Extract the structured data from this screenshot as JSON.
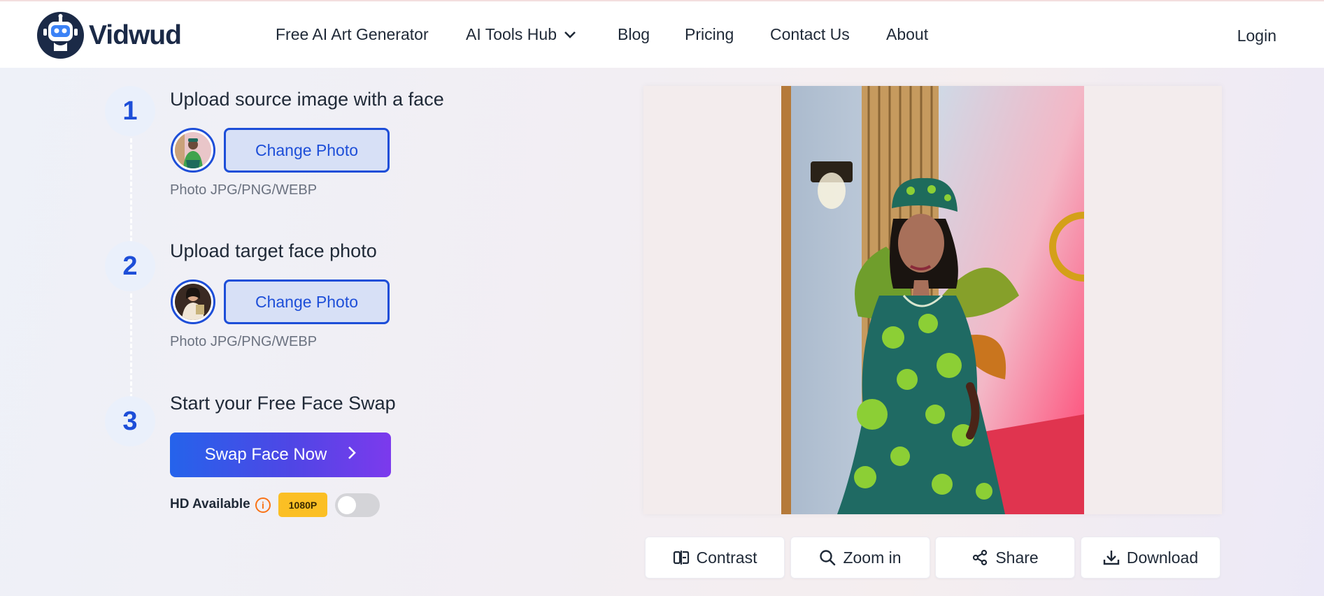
{
  "header": {
    "logo_text": "Vidwud",
    "nav": [
      {
        "label": "Free AI Art Generator"
      },
      {
        "label": "AI Tools Hub"
      },
      {
        "label": "Blog"
      },
      {
        "label": "Pricing"
      },
      {
        "label": "Contact Us"
      },
      {
        "label": "About"
      }
    ],
    "login": "Login"
  },
  "steps": [
    {
      "number": "1",
      "title": "Upload source image with a face",
      "button": "Change Photo",
      "hint": "Photo JPG/PNG/WEBP"
    },
    {
      "number": "2",
      "title": "Upload target face photo",
      "button": "Change Photo",
      "hint": "Photo JPG/PNG/WEBP"
    },
    {
      "number": "3",
      "title": "Start your Free Face Swap",
      "button": "Swap Face Now"
    }
  ],
  "hd": {
    "label": "HD Available",
    "info_icon": "info-icon",
    "badge": "1080P",
    "toggle_on": false
  },
  "actions": [
    {
      "label": "Contrast",
      "icon": "contrast-icon"
    },
    {
      "label": "Zoom in",
      "icon": "search-icon"
    },
    {
      "label": "Share",
      "icon": "share-icon"
    },
    {
      "label": "Download",
      "icon": "download-icon"
    }
  ],
  "colors": {
    "accent": "#1d4ed8",
    "gradient_start": "#2563eb",
    "gradient_end": "#7c3aed",
    "badge": "#fbbf24"
  }
}
